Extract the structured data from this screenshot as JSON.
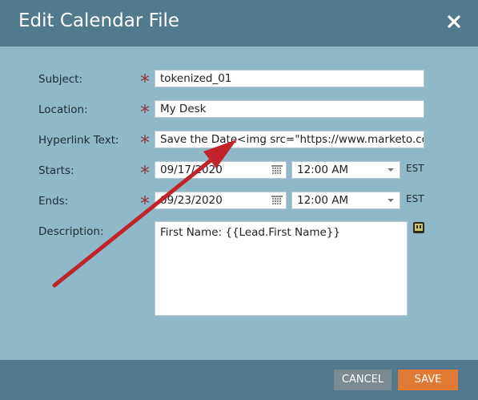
{
  "dialog": {
    "title": "Edit Calendar File"
  },
  "fields": {
    "subject": {
      "label": "Subject:",
      "value": "tokenized_01"
    },
    "location": {
      "label": "Location:",
      "value": "My Desk"
    },
    "hyperlink": {
      "label": "Hyperlink Text:",
      "value": "Save the Date<img src=\"https://www.marketo.com"
    },
    "starts": {
      "label": "Starts:",
      "date": "09/17/2020",
      "time": "12:00 AM",
      "timezone": "EST"
    },
    "ends": {
      "label": "Ends:",
      "date": "09/23/2020",
      "time": "12:00 AM",
      "timezone": "EST"
    },
    "description": {
      "label": "Description:",
      "value": "First Name: {{Lead.First Name}}"
    },
    "required_marker": "*"
  },
  "footer": {
    "cancel_label": "CANCEL",
    "save_label": "SAVE"
  },
  "colors": {
    "titlebar": "#517a8e",
    "body": "#8fb8c9",
    "save": "#e07a34",
    "cancel": "#7a8a93",
    "annotation_arrow": "#c0242a"
  },
  "icons": {
    "close": "close-icon",
    "calendar": "calendar-icon",
    "dropdown": "chevron-down-icon",
    "token": "token-icon"
  }
}
